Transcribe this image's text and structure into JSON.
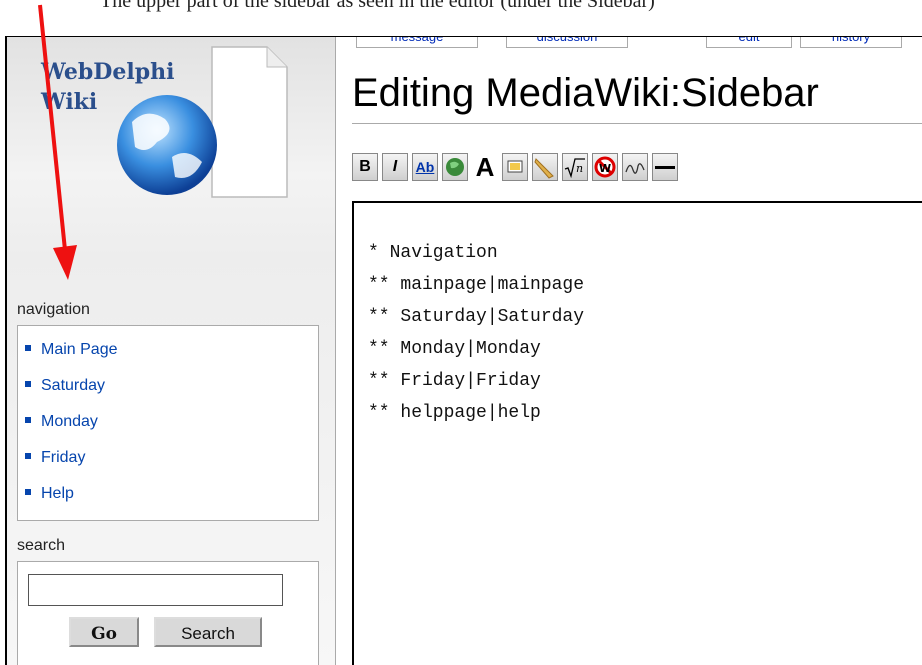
{
  "caption_fragment": "The upper part of the sidebar as seen in the editor (under the Sidebar)",
  "logo": {
    "line1": "WebDelphi",
    "line2": "Wiki"
  },
  "tabs": [
    "message",
    "discussion",
    "edit",
    "history"
  ],
  "page_title": "Editing MediaWiki:Sidebar",
  "toolbar": {
    "bold": "B",
    "italic": "I",
    "link": "Ab",
    "big_a": "A"
  },
  "navigation": {
    "title": "navigation",
    "items": [
      "Main Page",
      "Saturday",
      "Monday",
      "Friday",
      "Help"
    ]
  },
  "search": {
    "title": "search",
    "input_value": "",
    "go_label": "Go",
    "search_label": "Search"
  },
  "editor_lines": [
    "* Navigation",
    "** mainpage|mainpage",
    "** Saturday|Saturday",
    "** Monday|Monday",
    "** Friday|Friday",
    "** helppage|help"
  ],
  "colors": {
    "link": "#0645ad",
    "arrow": "#ee1111"
  }
}
